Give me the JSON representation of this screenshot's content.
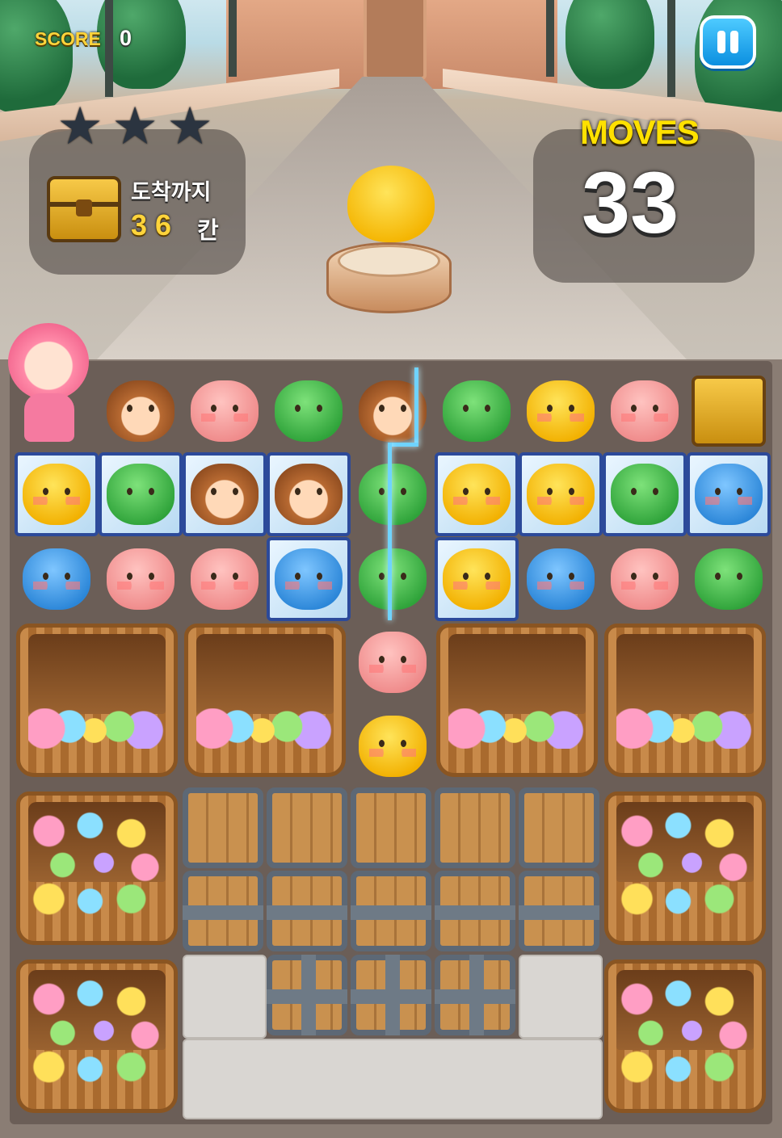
{
  "hud": {
    "score_label": "SCORE",
    "score_value": "0",
    "stars_earned": 0,
    "stars_total": 3,
    "goal_label": "도착까지",
    "goal_number": "36",
    "goal_unit": "칸",
    "moves_label": "MOVES",
    "moves_value": "33"
  },
  "board": {
    "rows": [
      [
        "character",
        "monkey",
        "pig",
        "bear",
        "monkey",
        "bear",
        "chick",
        "pig",
        "chest"
      ],
      [
        "chick",
        "bear",
        "monkey",
        "monkey",
        "bear",
        "chick",
        "chick",
        "bear",
        "dog"
      ],
      [
        "dog",
        "pig",
        "pig",
        "dog",
        "bear",
        "chick",
        "dog",
        "pig",
        "bear"
      ],
      [
        "basket",
        "basket",
        "basket",
        "basket",
        "pig",
        "basket",
        "basket",
        "basket",
        "basket"
      ],
      [
        "basket",
        "basket",
        "chick",
        "basket",
        "basket",
        "basket",
        "basket",
        "basket",
        "basket"
      ]
    ],
    "iced_cells_row1": [
      0,
      1,
      2,
      3,
      5,
      6,
      7,
      8
    ],
    "iced_cells_row2": [
      3,
      5
    ]
  },
  "colors": {
    "score": "#ffd43b",
    "moves_label": "#ffe100",
    "pause": "#0b8fe0"
  }
}
